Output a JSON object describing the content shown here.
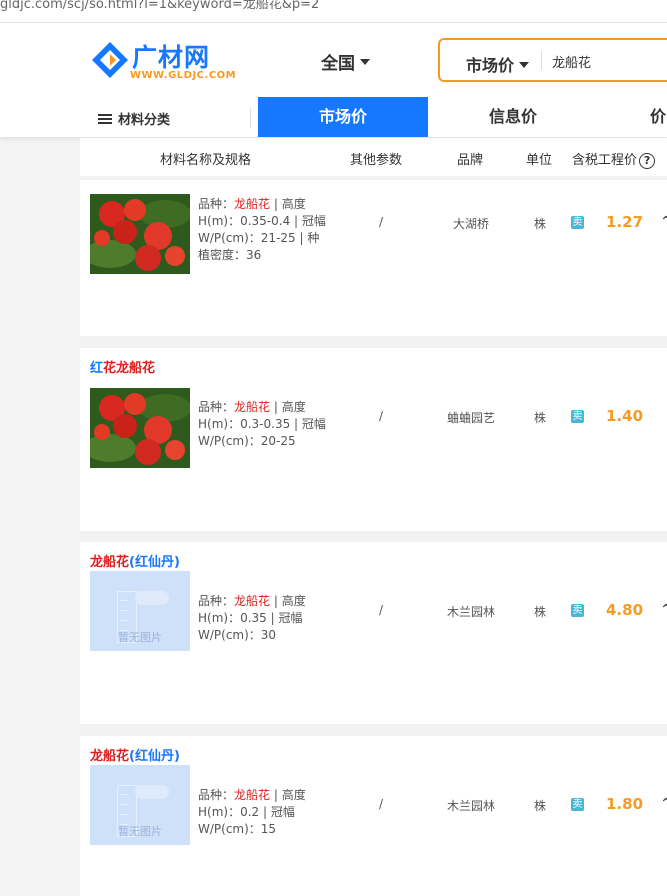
{
  "url": "gldjc.com/scj/so.html?l=1&keyword=龙船花&p=2",
  "brand": {
    "name": "广材网",
    "domain": "WWW.GLDJC.COM",
    "primary": "#1677ff",
    "accent": "#f59a23"
  },
  "header": {
    "region": "全国",
    "search_type": "市场价",
    "search_value": "龙船花"
  },
  "nav": {
    "category": "材料分类",
    "tabs": [
      "市场价",
      "信息价",
      "价"
    ]
  },
  "table_headers": {
    "name": "材料名称及规格",
    "params": "其他参数",
    "brand": "品牌",
    "unit": "单位",
    "price": "含税工程价",
    "help": "?"
  },
  "items": [
    {
      "title_part1": "",
      "title_part2": "",
      "title_part3": "",
      "spec_label": "品种：",
      "spec_variety": "龙船花",
      "spec_rest1": " | 高度",
      "spec_line2": "H(m)：0.35-0.4 | 冠幅",
      "spec_line3": "W/P(cm)：21-25 | 种",
      "spec_line4": "植密度：36",
      "params": "/",
      "brand": "大湖桥",
      "unit": "株",
      "sell": "卖",
      "price": "1.27",
      "image": "photo"
    },
    {
      "title_part1": "红",
      "title_part2": "花龙船花",
      "title_part3": "",
      "spec_label": "品种：",
      "spec_variety": "龙船花",
      "spec_rest1": " | 高度",
      "spec_line2": "H(m)：0.3-0.35 | 冠幅",
      "spec_line3": "W/P(cm)：20-25",
      "spec_line4": "",
      "params": "/",
      "brand": "蛐蛐园艺",
      "unit": "株",
      "sell": "卖",
      "price": "1.40",
      "image": "photo"
    },
    {
      "title_part1": "龙船花",
      "title_part2": "(红仙丹)",
      "title_part3": "",
      "spec_label": "品种：",
      "spec_variety": "龙船花",
      "spec_rest1": " | 高度",
      "spec_line2": "H(m)：0.35 | 冠幅",
      "spec_line3": "W/P(cm)：30",
      "spec_line4": "",
      "params": "/",
      "brand": "木兰园林",
      "unit": "株",
      "sell": "卖",
      "price": "4.80",
      "image": "none",
      "noimg_text": "暂无图片"
    },
    {
      "title_part1": "龙船花",
      "title_part2": "(红仙丹)",
      "title_part3": "",
      "spec_label": "品种：",
      "spec_variety": "龙船花",
      "spec_rest1": " | 高度",
      "spec_line2": "H(m)：0.2 | 冠幅",
      "spec_line3": "W/P(cm)：15",
      "spec_line4": "",
      "params": "/",
      "brand": "木兰园林",
      "unit": "株",
      "sell": "卖",
      "price": "1.80",
      "image": "none",
      "noimg_text": "暂无图片"
    }
  ]
}
